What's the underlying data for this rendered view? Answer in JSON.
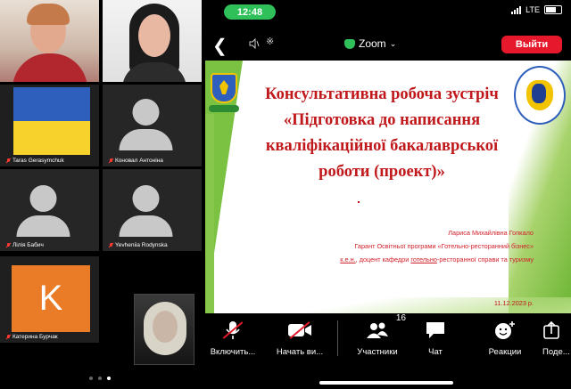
{
  "gallery": {
    "tiles": [
      {
        "name": ""
      },
      {
        "name": ""
      },
      {
        "name": "Taras Gerasymchuk"
      },
      {
        "name": "Коновал Антоніна"
      },
      {
        "name": "Лілія Бабич"
      },
      {
        "name": "Yevheniia Rodynska"
      },
      {
        "name": "Катерина Бурчак"
      }
    ],
    "k_avatar_letter": "K",
    "page_count": 3,
    "active_page": 3
  },
  "status_bar": {
    "time": "12:48",
    "network": "LTE",
    "time_color": "#2fc05a"
  },
  "zoom_bar": {
    "back_icon": "back-arrow-icon",
    "title": "Zoom",
    "leave_label": "Выйти",
    "leave_color": "#e5192b"
  },
  "slide": {
    "title_lines": [
      "Консультативна робоча зустріч",
      "«Підготовка до написання",
      "кваліфікаційної бакалаврської",
      "роботи (проект)»"
    ],
    "author": "Лариса Михайлівна Гопкало",
    "role_line1": "Гарант Освітньої програми «Готельно-ресторанний бізнес»",
    "role_line2_a": "к.е.н.",
    "role_line2_b": ", доцент кафедри ",
    "role_line2_c": "готельно",
    "role_line2_d": "-ресторанної справи та туризму",
    "date": "11.12.2023 р.",
    "title_color": "#c0181b",
    "accent_green": "#7cc242"
  },
  "toolbar": {
    "items": [
      {
        "label": "Включить...",
        "icon": "microphone-muted-icon"
      },
      {
        "label": "Начать ви...",
        "icon": "video-off-icon"
      },
      {
        "label": "Участники",
        "icon": "participants-icon",
        "count": "16"
      },
      {
        "label": "Чат",
        "icon": "chat-icon"
      },
      {
        "label": "Реакции",
        "icon": "reactions-icon"
      },
      {
        "label": "Поде...",
        "icon": "share-icon"
      }
    ]
  }
}
